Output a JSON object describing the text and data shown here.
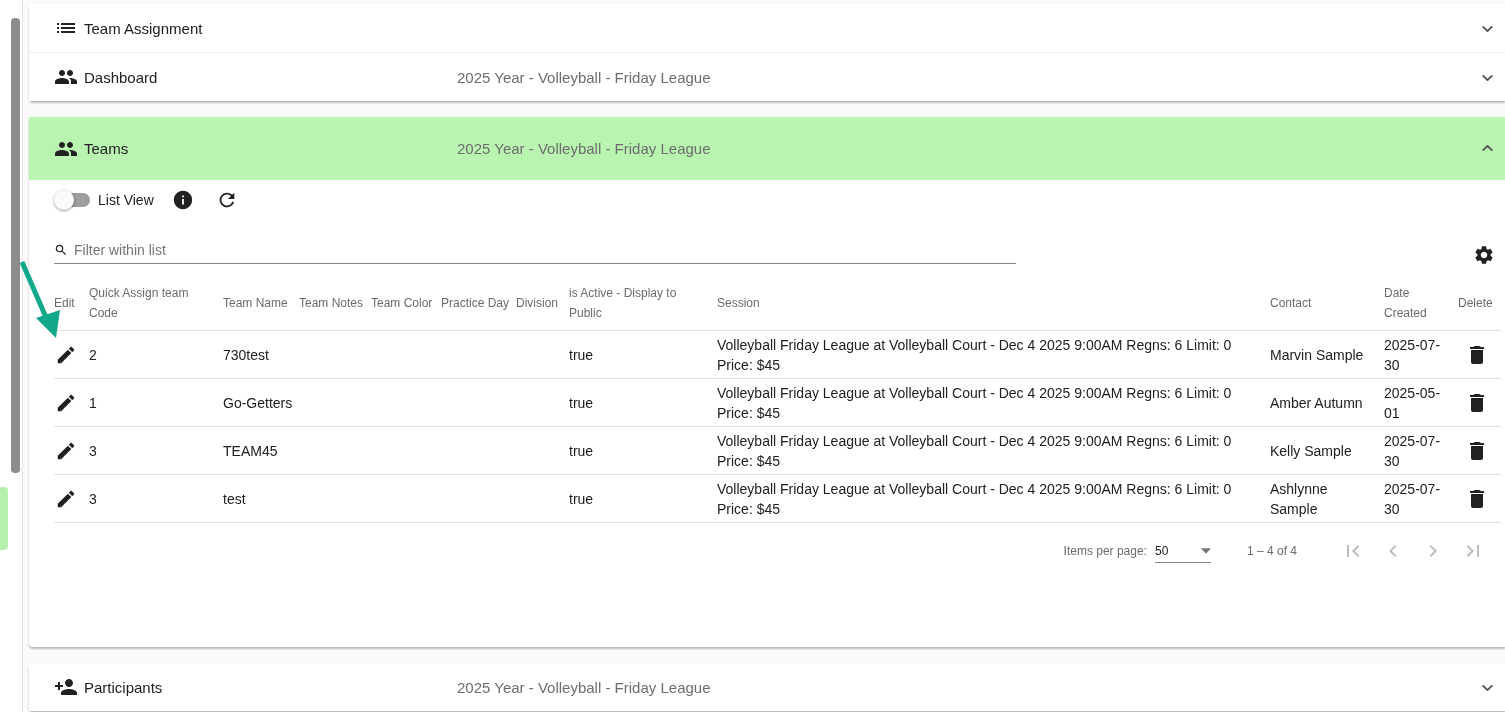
{
  "panels": [
    {
      "title": "Team Assignment",
      "expanded": false
    },
    {
      "title": "Dashboard",
      "subtitle": "2025 Year - Volleyball - Friday League",
      "expanded": false
    },
    {
      "title": "Teams",
      "subtitle": "2025 Year - Volleyball - Friday League",
      "expanded": true
    },
    {
      "title": "Participants",
      "subtitle": "2025 Year - Volleyball - Friday League",
      "expanded": false
    }
  ],
  "toolbar": {
    "list_view": {
      "label": "List View",
      "on": false
    }
  },
  "filter": {
    "placeholder": "Filter within list"
  },
  "table": {
    "columns": [
      "Edit",
      "Quick Assign team Code",
      "Team Name",
      "Team Notes",
      "Team Color",
      "Practice Day",
      "Division",
      "is Active - Display to Public",
      "Session",
      "Contact",
      "Date Created",
      "Delete"
    ],
    "rows": [
      {
        "code": "2",
        "team_name": "730test",
        "active": "true",
        "session": "Volleyball Friday League at Volleyball Court - Dec 4 2025 9:00AM Regns: 6 Limit: 0 Price: $45",
        "contact": "Marvin Sample",
        "date_created": "2025-07-30"
      },
      {
        "code": "1",
        "team_name": "Go-Getters",
        "active": "true",
        "session": "Volleyball Friday League at Volleyball Court - Dec 4 2025 9:00AM Regns: 6 Limit: 0 Price: $45",
        "contact": "Amber Autumn",
        "date_created": "2025-05-01"
      },
      {
        "code": "3",
        "team_name": "TEAM45",
        "active": "true",
        "session": "Volleyball Friday League at Volleyball Court - Dec 4 2025 9:00AM Regns: 6 Limit: 0 Price: $45",
        "contact": "Kelly Sample",
        "date_created": "2025-07-30"
      },
      {
        "code": "3",
        "team_name": "test",
        "active": "true",
        "session": "Volleyball Friday League at Volleyball Court - Dec 4 2025 9:00AM Regns: 6 Limit: 0 Price: $45",
        "contact": "Ashlynne Sample",
        "date_created": "2025-07-30"
      }
    ]
  },
  "paginator": {
    "items_per_page_label": "Items per page:",
    "items_per_page": "50",
    "range": "1 – 4 of 4"
  }
}
